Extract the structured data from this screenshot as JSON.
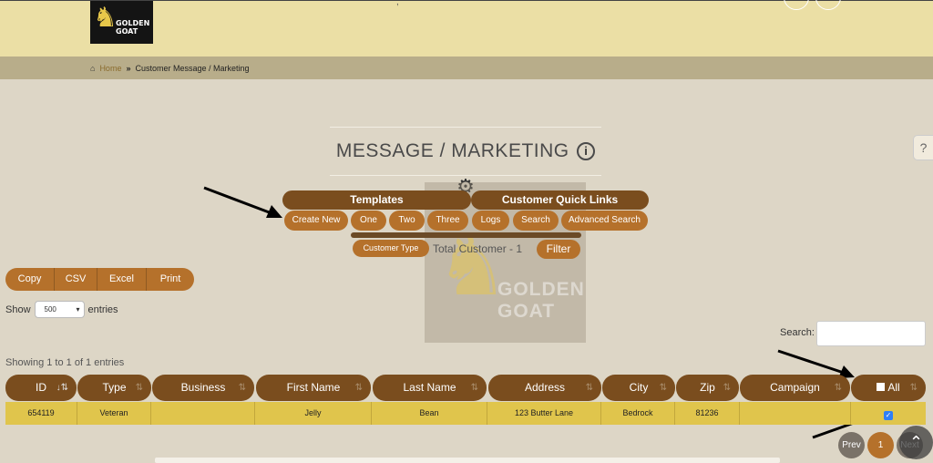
{
  "brand": {
    "logo_text": "GOLDEN\nGOAT"
  },
  "breadcrumb": {
    "home": "Home",
    "current": "Customer Message / Marketing"
  },
  "page": {
    "title": "MESSAGE / MARKETING",
    "help_tab": "?"
  },
  "watermark": {
    "text": "GOLDEN\nGOAT"
  },
  "groups": {
    "templates": "Templates",
    "quick_links": "Customer Quick Links"
  },
  "buttons": {
    "create_new": "Create New",
    "one": "One",
    "two": "Two",
    "three": "Three",
    "logs": "Logs",
    "search": "Search",
    "advanced_search": "Advanced Search",
    "customer_type": "Customer Type",
    "filter": "Filter"
  },
  "total_customer": "Total Customer - 1",
  "export": {
    "copy": "Copy",
    "csv": "CSV",
    "excel": "Excel",
    "print": "Print"
  },
  "length": {
    "show": "Show",
    "value": "500",
    "entries": "entries"
  },
  "search_label": "Search:",
  "info": "Showing 1 to 1 of 1 entries",
  "table": {
    "columns": [
      "ID",
      "Type",
      "Business",
      "First Name",
      "Last Name",
      "Address",
      "City",
      "Zip",
      "Campaign",
      "All"
    ],
    "rows": [
      {
        "id": "654119",
        "type": "Veteran",
        "business": "",
        "first_name": "Jelly",
        "last_name": "Bean",
        "address": "123 Butter Lane",
        "city": "Bedrock",
        "zip": "81236",
        "campaign": "",
        "selected": true
      }
    ]
  },
  "pagination": {
    "prev": "Prev",
    "page": "1",
    "next": "Next"
  },
  "colors": {
    "brown_dark": "#7a4d1e",
    "brown": "#b5712b",
    "row_yellow": "#e0c54c",
    "header_bg": "#ebdfa5"
  }
}
